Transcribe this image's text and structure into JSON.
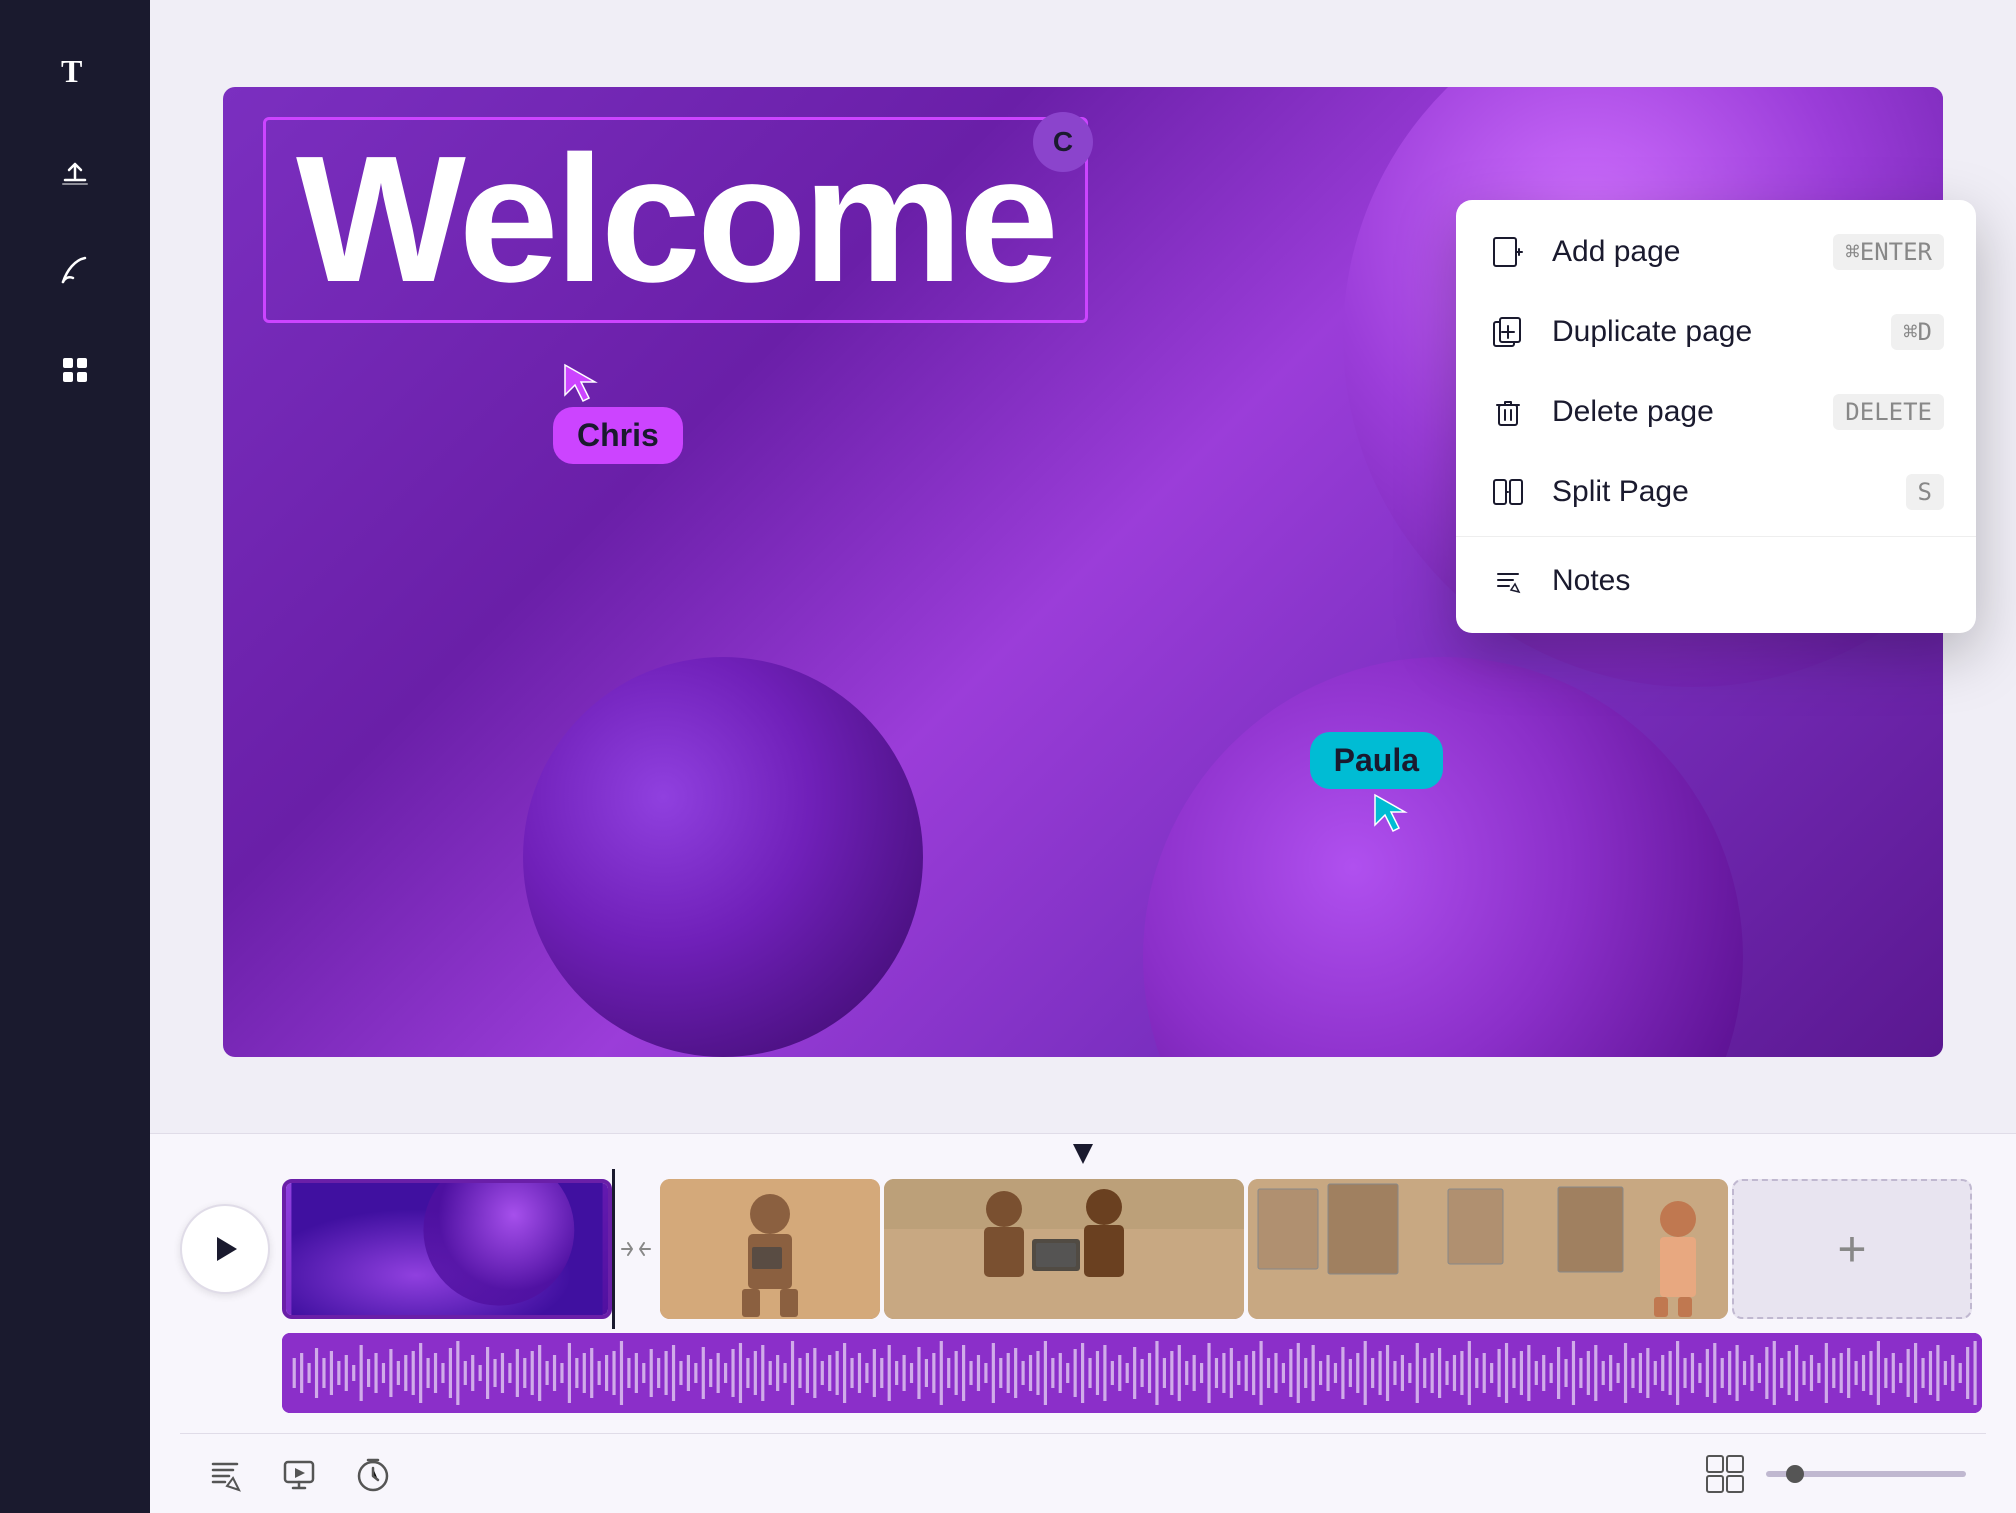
{
  "sidebar": {
    "icons": [
      {
        "name": "text-icon",
        "label": "T",
        "interactable": true
      },
      {
        "name": "upload-icon",
        "label": "upload",
        "interactable": true
      },
      {
        "name": "draw-icon",
        "label": "draw",
        "interactable": true
      },
      {
        "name": "grid-icon",
        "label": "grid",
        "interactable": true
      }
    ]
  },
  "canvas": {
    "welcome_text": "Welcome",
    "c_avatar": "C",
    "collaborator_chris": "Chris",
    "collaborator_paula": "Paula"
  },
  "context_menu": {
    "items": [
      {
        "label": "Add page",
        "shortcut": "⌘ENTER",
        "icon": "add-page-icon"
      },
      {
        "label": "Duplicate page",
        "shortcut": "⌘D",
        "icon": "duplicate-page-icon"
      },
      {
        "label": "Delete page",
        "shortcut": "DELETE",
        "icon": "delete-page-icon"
      },
      {
        "label": "Split Page",
        "shortcut": "S",
        "icon": "split-page-icon"
      },
      {
        "label": "Notes",
        "shortcut": "",
        "icon": "notes-icon"
      }
    ]
  },
  "timeline": {
    "play_button_label": "▶",
    "add_clip_label": "+",
    "clips": [
      {
        "id": "clip-1",
        "type": "purple-abstract",
        "active": true
      },
      {
        "id": "clip-2",
        "type": "person-standing"
      },
      {
        "id": "clip-3",
        "type": "two-people-tablet"
      },
      {
        "id": "clip-4",
        "type": "woman-art-gallery"
      }
    ]
  },
  "bottom_toolbar": {
    "icons": [
      {
        "name": "script-icon",
        "label": "script"
      },
      {
        "name": "preview-icon",
        "label": "preview"
      },
      {
        "name": "timer-icon",
        "label": "timer"
      }
    ],
    "layout_icon": "layout",
    "zoom_level": "zoom"
  }
}
